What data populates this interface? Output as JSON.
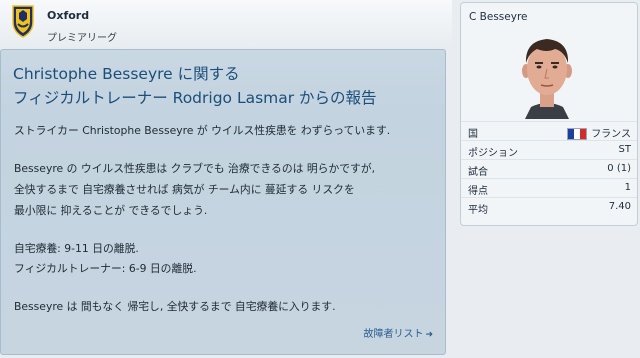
{
  "header": {
    "club_name": "Oxford",
    "league": "プレミアリーグ"
  },
  "message": {
    "title_line1": "Christophe Besseyre に関する",
    "title_line2": "フィジカルトレーナー Rodrigo Lasmar からの報告",
    "body": [
      "ストライカー Christophe Besseyre が ウイルス性疾患を わずらっています.",
      "Besseyre の ウイルス性疾患は クラブでも 治療できるのは 明らかですが,",
      "全快するまで 自宅療養させれば 病気が チーム内に 蔓延する リスクを",
      "最小限に 抑えることが できるでしょう.",
      "自宅療養: 9-11 日の離脱.",
      "フィジカルトレーナー: 6-9 日の離脱.",
      "Besseyre は 間もなく 帰宅し, 全快するまで 自宅療養に入ります."
    ],
    "link_label": "故障者リスト"
  },
  "player_card": {
    "name": "C Besseyre",
    "stats": [
      {
        "label": "国",
        "value": "フランス"
      },
      {
        "label": "ポジション",
        "value": "ST"
      },
      {
        "label": "試合",
        "value": "0 (1)"
      },
      {
        "label": "得点",
        "value": "1"
      },
      {
        "label": "平均",
        "value": "7.40"
      }
    ]
  },
  "colors": {
    "title": "#1c4e7a",
    "panel_bg": "#c6d5e0",
    "link": "#2b5d8e",
    "flag_blue": "#1f3fa0",
    "flag_white": "#ffffff",
    "flag_red": "#d42a2a"
  },
  "icons": {
    "club_crest": "club-crest-icon",
    "link_arrow": "arrow-right-icon",
    "country_flag": "france-flag-icon"
  }
}
